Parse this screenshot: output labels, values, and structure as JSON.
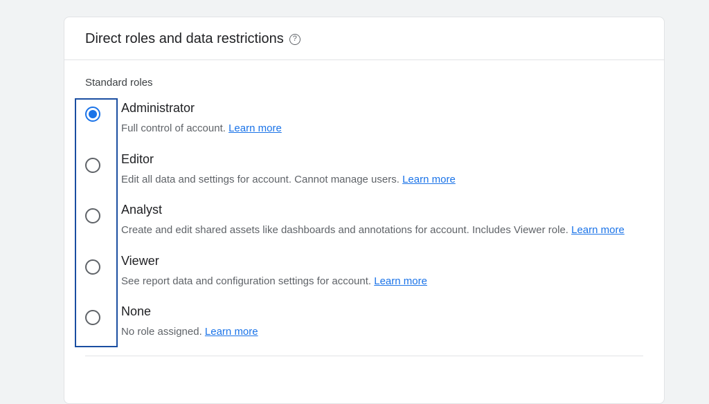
{
  "header": {
    "title": "Direct roles and data restrictions"
  },
  "section": {
    "label": "Standard roles"
  },
  "roles": [
    {
      "name": "Administrator",
      "desc": "Full control of account. ",
      "learn": "Learn more",
      "selected": true
    },
    {
      "name": "Editor",
      "desc": "Edit all data and settings for account. Cannot manage users. ",
      "learn": "Learn more",
      "selected": false
    },
    {
      "name": "Analyst",
      "desc": "Create and edit shared assets like dashboards and annotations for account. Includes Viewer role. ",
      "learn": "Learn more",
      "selected": false
    },
    {
      "name": "Viewer",
      "desc": "See report data and configuration settings for account. ",
      "learn": "Learn more",
      "selected": false
    },
    {
      "name": "None",
      "desc": "No role assigned. ",
      "learn": "Learn more",
      "selected": false
    }
  ]
}
